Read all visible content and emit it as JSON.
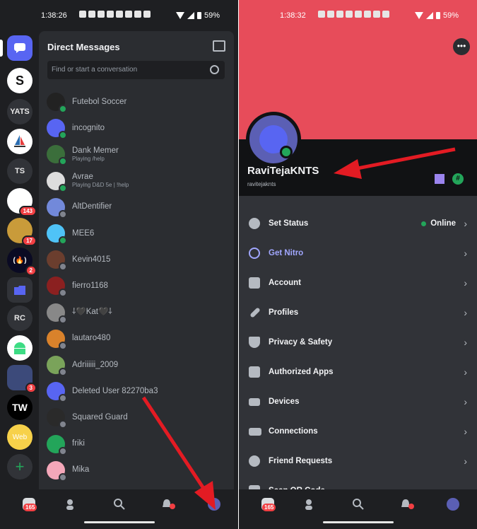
{
  "status_left": {
    "time": "1:38:26",
    "battery": "59%"
  },
  "status_right": {
    "time": "1:38:32",
    "battery": "59%"
  },
  "servers": [
    {
      "label": "",
      "kind": "dm"
    },
    {
      "label": "S"
    },
    {
      "label": "YATS"
    },
    {
      "label": ""
    },
    {
      "label": "TS"
    },
    {
      "label": "",
      "badge": "143"
    },
    {
      "label": "",
      "badge": "17"
    },
    {
      "label": "",
      "badge": "2"
    },
    {
      "label": ""
    },
    {
      "label": "RC"
    },
    {
      "label": ""
    },
    {
      "label": "",
      "badge": "3"
    },
    {
      "label": "TW"
    },
    {
      "label": "Web"
    },
    {
      "label": "+"
    }
  ],
  "dm": {
    "title": "Direct Messages",
    "search_placeholder": "Find or start a conversation",
    "items": [
      {
        "name": "Futebol Soccer",
        "status": "online",
        "color": "#222"
      },
      {
        "name": "incognito",
        "status": "online",
        "color": "#5865f2"
      },
      {
        "name": "Dank Memer",
        "sub": "Playing /help",
        "status": "online",
        "color": "#3b6e3b"
      },
      {
        "name": "Avrae",
        "sub": "Playing D&D 5e | !help",
        "status": "online",
        "color": "#ddd"
      },
      {
        "name": "AltDentifier",
        "status": "offline",
        "color": "#7289da"
      },
      {
        "name": "MEE6",
        "status": "online",
        "color": "#4fc3f7"
      },
      {
        "name": "Kevin4015",
        "status": "offline",
        "color": "#6b3e2e"
      },
      {
        "name": "fierro1168",
        "status": "offline",
        "color": "#8b2020"
      },
      {
        "name": "⸸🖤Kat🖤⸸",
        "status": "offline",
        "color": "#888"
      },
      {
        "name": "lautaro480",
        "status": "offline",
        "color": "#d9822b"
      },
      {
        "name": "Adriiiiii_2009",
        "status": "offline",
        "color": "#7aa35a"
      },
      {
        "name": "Deleted User 82270ba3",
        "status": "offline",
        "color": "#5865f2"
      },
      {
        "name": "Squared Guard",
        "status": "offline",
        "color": "#2a2a2a"
      },
      {
        "name": "friki",
        "status": "offline",
        "color": "#23a55a"
      },
      {
        "name": "Mika",
        "status": "offline",
        "color": "#f4a7b9"
      }
    ]
  },
  "nav_left": {
    "home_badge": "165"
  },
  "nav_right": {
    "home_badge": "165"
  },
  "profile": {
    "display_name": "RaviTejaKNTS",
    "username": "ravitejaknts",
    "banner_color": "#e74c5a",
    "more_label": "•••",
    "hash_badge": "#"
  },
  "menu": {
    "items": [
      {
        "label": "Set Status",
        "value": "Online"
      },
      {
        "label": "Get Nitro"
      },
      {
        "label": "Account"
      },
      {
        "label": "Profiles"
      },
      {
        "label": "Privacy & Safety"
      },
      {
        "label": "Authorized Apps"
      },
      {
        "label": "Devices"
      },
      {
        "label": "Connections"
      },
      {
        "label": "Friend Requests"
      },
      {
        "label": "Scan QR Code"
      }
    ]
  },
  "colors": {
    "accent": "#5865f2",
    "online": "#23a55a",
    "danger": "#f23f43",
    "arrow": "#e31b23"
  }
}
